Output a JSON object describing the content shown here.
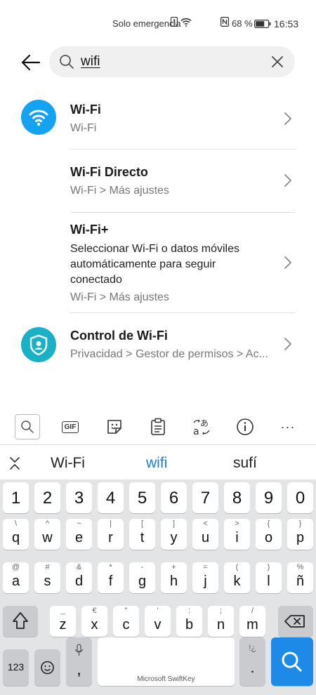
{
  "status_bar": {
    "emergency": "Solo emergencia",
    "battery_pct": "68 %",
    "time": "16:53"
  },
  "search": {
    "query": "wifi"
  },
  "results": [
    {
      "title": "Wi-Fi",
      "path": "Wi-Fi",
      "icon": "wifi-icon"
    },
    {
      "title": "Wi-Fi Directo",
      "path": "Wi-Fi > Más ajustes"
    },
    {
      "title": "Wi-Fi+",
      "description": "Seleccionar Wi-Fi o datos móviles automáticamente para seguir conectado",
      "path": "Wi-Fi > Más ajustes"
    },
    {
      "title": "Control de Wi-Fi",
      "path": "Privacidad > Gestor de permisos > Ac...",
      "icon": "shield-user-icon"
    }
  ],
  "keyboard_toolbar": {
    "gif_label": "GIF",
    "more_label": "···"
  },
  "suggestions": [
    "Wi-Fi",
    "wifi",
    "sufí"
  ],
  "keyboard": {
    "numbers": [
      "1",
      "2",
      "3",
      "4",
      "5",
      "6",
      "7",
      "8",
      "9",
      "0"
    ],
    "row1": [
      [
        "q",
        "\\"
      ],
      [
        "w",
        "^"
      ],
      [
        "e",
        "~"
      ],
      [
        "r",
        "|"
      ],
      [
        "t",
        "["
      ],
      [
        "y",
        "]"
      ],
      [
        "u",
        "<"
      ],
      [
        "i",
        ">"
      ],
      [
        "o",
        "{"
      ],
      [
        "p",
        "}"
      ]
    ],
    "row2": [
      [
        "a",
        "@"
      ],
      [
        "s",
        "#"
      ],
      [
        "d",
        "&"
      ],
      [
        "f",
        "*"
      ],
      [
        "g",
        "-"
      ],
      [
        "h",
        "+"
      ],
      [
        "j",
        "="
      ],
      [
        "k",
        "("
      ],
      [
        "l",
        ")"
      ],
      [
        "ñ",
        "%"
      ]
    ],
    "row3": [
      [
        "z",
        "_"
      ],
      [
        "x",
        "€"
      ],
      [
        "c",
        "\""
      ],
      [
        "v",
        "'"
      ],
      [
        "b",
        ":"
      ],
      [
        "n",
        ";"
      ],
      [
        "m",
        "/"
      ]
    ],
    "num_switch": "123",
    "comma": ",",
    "period": ".",
    "period_alt": "!¿",
    "space_label": "Microsoft SwiftKey"
  },
  "colors": {
    "wifi_icon_bg": "#14a3f0",
    "control_icon_bg": "#1ab1c6",
    "active_suggestion": "#1a7fd6",
    "search_key": "#1c8ae6"
  }
}
